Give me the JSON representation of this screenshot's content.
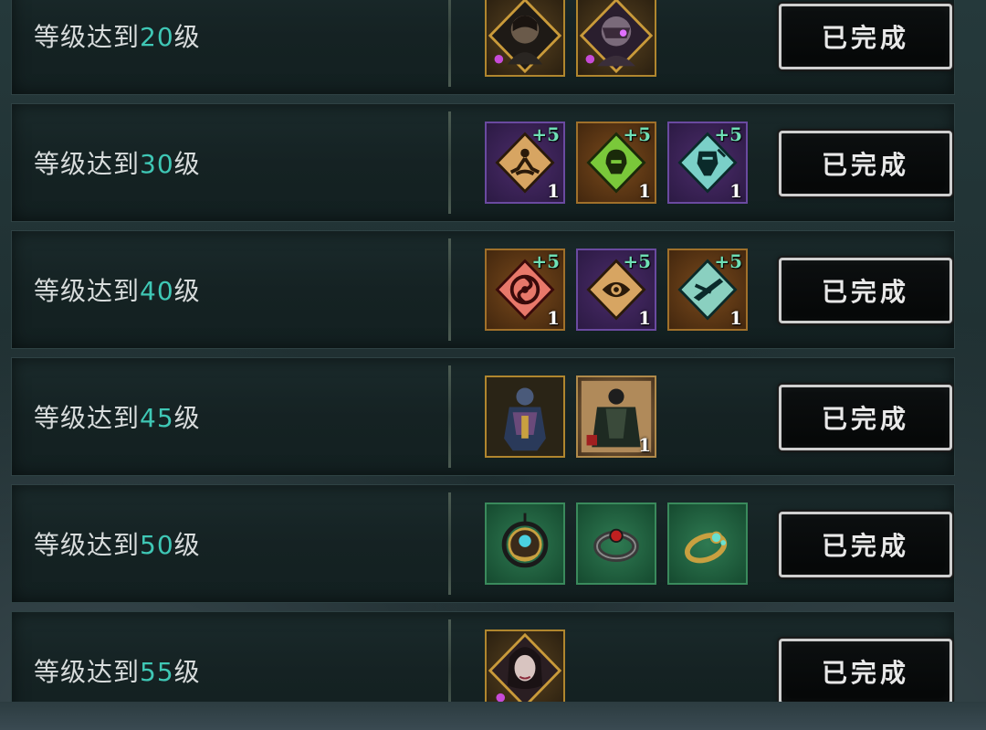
{
  "rows": [
    {
      "prefix": "等级达到",
      "level": "20",
      "suffix": "级",
      "rewards": [
        {
          "type": "portrait",
          "rarity": "gold",
          "icon": "character-portrait-male"
        },
        {
          "type": "portrait",
          "rarity": "gold",
          "icon": "character-portrait-masked"
        }
      ],
      "button": "已完成"
    },
    {
      "prefix": "等级达到",
      "level": "30",
      "suffix": "级",
      "rewards": [
        {
          "type": "rune",
          "rarity": "purple",
          "icon": "meditation-rune-icon",
          "badge": "+5",
          "qty": "1"
        },
        {
          "type": "rune",
          "rarity": "orange",
          "icon": "helmet-rune-icon",
          "badge": "+5",
          "qty": "1"
        },
        {
          "type": "rune",
          "rarity": "purple",
          "icon": "mask-rune-icon",
          "badge": "+5",
          "qty": "1"
        }
      ],
      "button": "已完成"
    },
    {
      "prefix": "等级达到",
      "level": "40",
      "suffix": "级",
      "rewards": [
        {
          "type": "rune",
          "rarity": "orange",
          "icon": "swirl-rune-icon",
          "badge": "+5",
          "qty": "1"
        },
        {
          "type": "rune",
          "rarity": "purple",
          "icon": "eye-rune-icon",
          "badge": "+5",
          "qty": "1"
        },
        {
          "type": "rune",
          "rarity": "orange",
          "icon": "blade-rune-icon",
          "badge": "+5",
          "qty": "1"
        }
      ],
      "button": "已完成"
    },
    {
      "prefix": "等级达到",
      "level": "45",
      "suffix": "级",
      "rewards": [
        {
          "type": "costume",
          "rarity": "gold",
          "icon": "armored-figure-icon"
        },
        {
          "type": "costume",
          "rarity": "parch",
          "icon": "cloak-costume-icon",
          "qty": "1"
        }
      ],
      "button": "已完成"
    },
    {
      "prefix": "等级达到",
      "level": "50",
      "suffix": "级",
      "rewards": [
        {
          "type": "jewel",
          "rarity": "green",
          "icon": "pendant-icon"
        },
        {
          "type": "jewel",
          "rarity": "green",
          "icon": "dark-ring-icon"
        },
        {
          "type": "jewel",
          "rarity": "green",
          "icon": "gold-ring-icon"
        }
      ],
      "button": "已完成"
    },
    {
      "prefix": "等级达到",
      "level": "55",
      "suffix": "级",
      "rewards": [
        {
          "type": "portrait",
          "rarity": "gold",
          "icon": "character-portrait-female"
        }
      ],
      "button": "已完成"
    }
  ]
}
